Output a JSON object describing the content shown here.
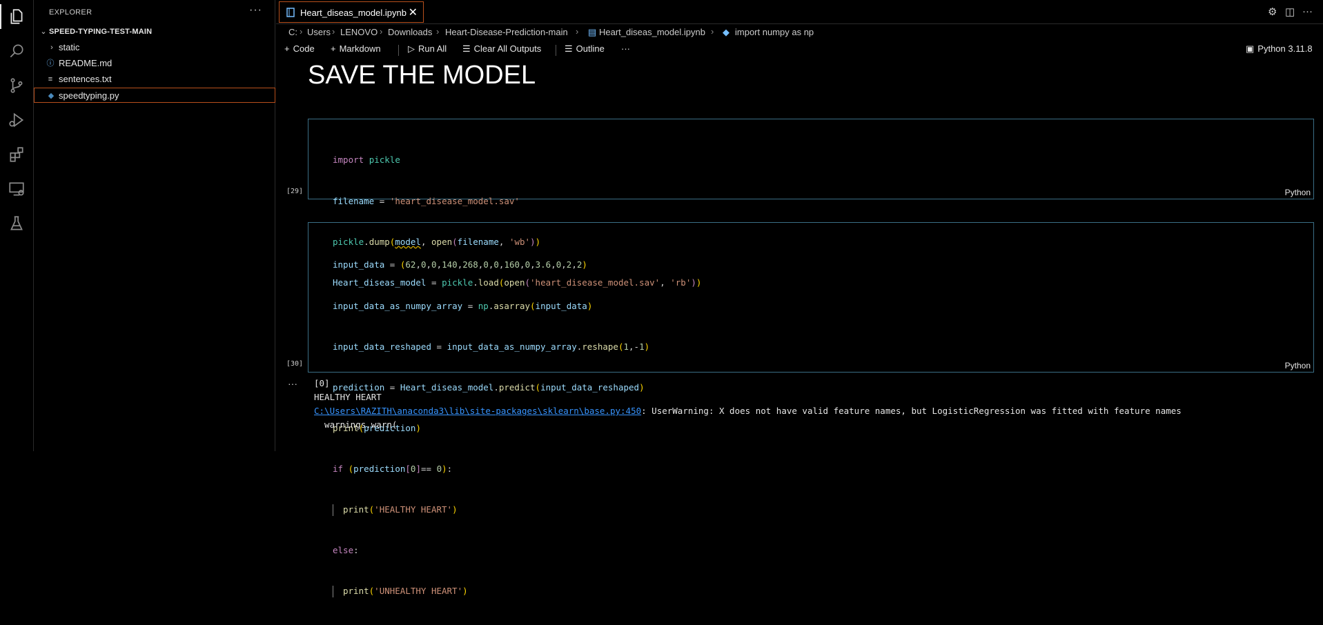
{
  "sidebar": {
    "title": "EXPLORER",
    "more": "···",
    "root": "SPEED-TYPING-TEST-MAIN",
    "items": [
      {
        "label": "static",
        "kind": "folder"
      },
      {
        "label": "README.md",
        "kind": "info"
      },
      {
        "label": "sentences.txt",
        "kind": "text"
      },
      {
        "label": "speedtyping.py",
        "kind": "python"
      }
    ]
  },
  "tab": {
    "label": "Heart_diseas_model.ipynb",
    "close": "✕"
  },
  "breadcrumb": [
    "C:",
    "Users",
    "LENOVO",
    "Downloads",
    "Heart-Disease-Prediction-main",
    "Heart_diseas_model.ipynb",
    "import numpy as np"
  ],
  "toolbar": {
    "code": "Code",
    "markdown": "Markdown",
    "run_all": "Run All",
    "clear_outputs": "Clear All Outputs",
    "outline": "Outline",
    "more": "···",
    "kernel": "Python 3.11.8"
  },
  "heading": "SAVE THE MODEL",
  "cells": [
    {
      "exec": "[29]",
      "lang": "Python",
      "lines": [
        "import pickle",
        "filename = 'heart_disease_model.sav'",
        "pickle.dump(model, open(filename, 'wb'))",
        "Heart_diseas_model = pickle.load(open('heart_disease_model.sav', 'rb'))"
      ]
    },
    {
      "exec": "[30]",
      "lang": "Python",
      "lines": [
        "input_data = (62,0,0,140,268,0,0,160,0,3.6,0,2,2)",
        "input_data_as_numpy_array = np.asarray(input_data)",
        "input_data_reshaped = input_data_as_numpy_array.reshape(1,-1)",
        "prediction = Heart_diseas_model.predict(input_data_reshaped)",
        "print(prediction)",
        "if (prediction[0]== 0):",
        "  print('HEALTHY HEART')",
        "else:",
        "  print('UNHEALTHY HEART')"
      ]
    }
  ],
  "output": {
    "more": "···",
    "result": "[0]",
    "verdict": "HEALTHY HEART",
    "warning_link": "C:\\Users\\RAZITH\\anaconda3\\lib\\site-packages\\sklearn\\base.py:450",
    "warning_text": ": UserWarning: X does not have valid feature names, but LogisticRegression was fitted with feature names",
    "warn_call": "  warnings.warn("
  }
}
